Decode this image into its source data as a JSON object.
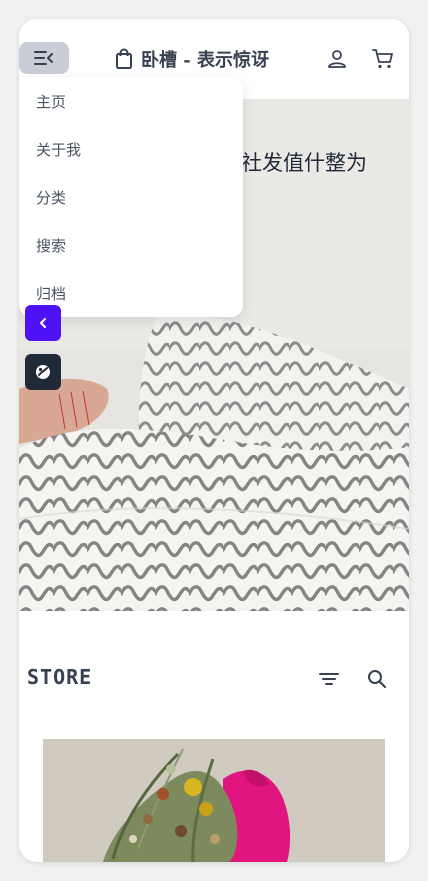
{
  "header": {
    "title": "卧槽 - 表示惊讶"
  },
  "hero": {
    "text": "社发值什整为"
  },
  "menu": {
    "items": [
      {
        "label": "主页"
      },
      {
        "label": "关于我"
      },
      {
        "label": "分类"
      },
      {
        "label": "搜索"
      },
      {
        "label": "归档"
      }
    ]
  },
  "store": {
    "title": "STORE"
  },
  "colors": {
    "accent": "#4f12f5",
    "dark": "#1f2937",
    "menu_button_bg": "#c9ced6"
  },
  "icons": [
    "menu-icon",
    "shopping-bag-icon",
    "user-icon",
    "cart-icon",
    "chevron-left-icon",
    "theme-icon",
    "filter-icon",
    "search-icon"
  ]
}
